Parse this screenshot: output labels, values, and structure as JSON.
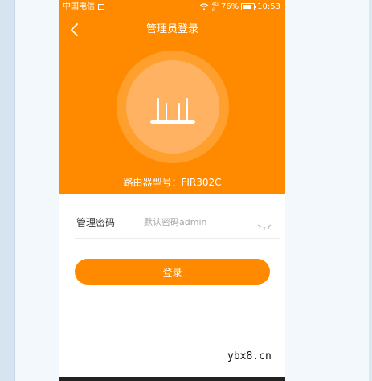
{
  "status_bar": {
    "carrier": "中国电信",
    "battery_percent": "76%",
    "battery_level": 0.76,
    "time": "10:53",
    "signal_top": "4G",
    "signal_bottom": "ıll"
  },
  "header": {
    "title": "管理员登录",
    "model_label": "路由器型号：FIR302C"
  },
  "form": {
    "password_label": "管理密码",
    "password_placeholder": "默认密码admin"
  },
  "login": {
    "button_label": "登录"
  },
  "watermark": "ybx8.cn",
  "colors": {
    "accent": "#ff8a00",
    "accent_light": "#ffb261"
  },
  "icons": [
    "back-arrow-icon",
    "router-icon",
    "eye-closed-icon",
    "wifi-icon",
    "battery-icon"
  ]
}
